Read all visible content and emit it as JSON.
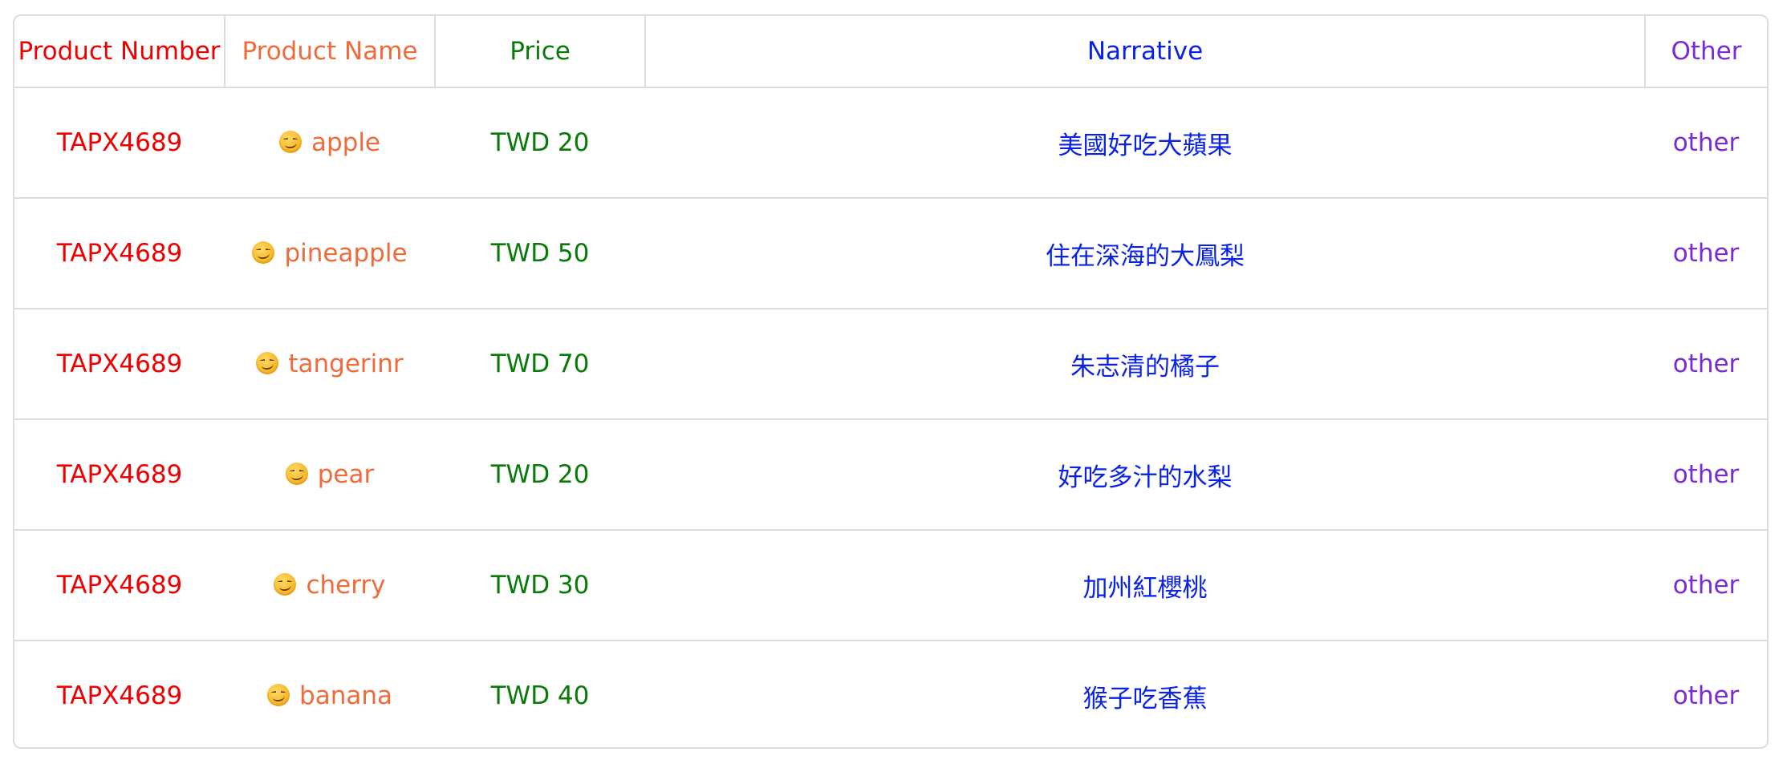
{
  "table": {
    "headers": {
      "product_number": "Product Number",
      "product_name": "Product Name",
      "price": "Price",
      "narrative": "Narrative",
      "other": "Other"
    },
    "rows": [
      {
        "product_number": "TAPX4689",
        "product_name": "apple",
        "price": "TWD 20",
        "narrative": "美國好吃大蘋果",
        "other": "other"
      },
      {
        "product_number": "TAPX4689",
        "product_name": "pineapple",
        "price": "TWD 50",
        "narrative": "住在深海的大鳳梨",
        "other": "other"
      },
      {
        "product_number": "TAPX4689",
        "product_name": "tangerinr",
        "price": "TWD 70",
        "narrative": "朱志清的橘子",
        "other": "other"
      },
      {
        "product_number": "TAPX4689",
        "product_name": "pear",
        "price": "TWD 20",
        "narrative": "好吃多汁的水梨",
        "other": "other"
      },
      {
        "product_number": "TAPX4689",
        "product_name": "cherry",
        "price": "TWD 30",
        "narrative": "加州紅櫻桃",
        "other": "other"
      },
      {
        "product_number": "TAPX4689",
        "product_name": "banana",
        "price": "TWD 40",
        "narrative": "猴子吃香蕉",
        "other": "other"
      }
    ],
    "name_icon": "smirking-face-icon"
  },
  "colors": {
    "product_number": "#ee0000",
    "product_name": "#f06a3a",
    "price": "#087a08",
    "narrative": "#0a22e6",
    "other": "#7a2bd6",
    "border": "#dcdcdc"
  }
}
